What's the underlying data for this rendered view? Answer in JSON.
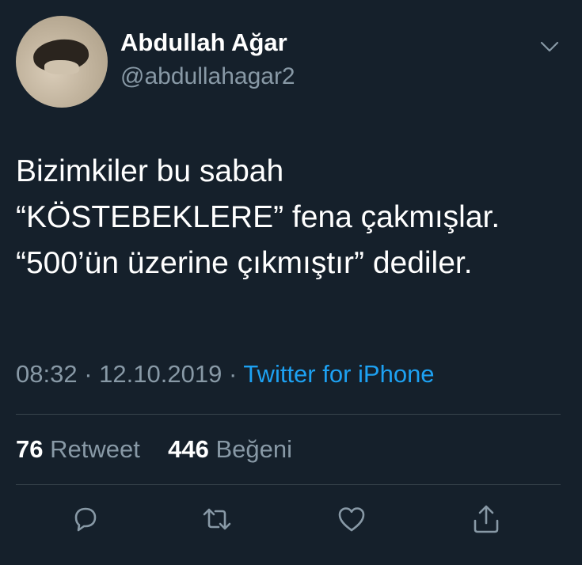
{
  "user": {
    "name": "Abdullah Ağar",
    "handle": "@abdullahagar2"
  },
  "tweet": {
    "lines": [
      "Bizimkiler bu sabah",
      "“KÖSTEBEKLERE” fena çakmışlar.",
      "“500’ün üzerine çıkmıştır” dediler."
    ],
    "time": "08:32",
    "separator": "·",
    "date": "12.10.2019",
    "source": "Twitter for iPhone"
  },
  "stats": {
    "retweets_count": "76",
    "retweets_label": "Retweet",
    "likes_count": "446",
    "likes_label": "Beğeni"
  },
  "icons": {
    "menu": "chevron-down-icon",
    "reply": "reply-icon",
    "retweet": "retweet-icon",
    "like": "heart-icon",
    "share": "share-icon"
  },
  "colors": {
    "background": "#15202b",
    "text": "#ffffff",
    "secondary": "#8899a6",
    "accent": "#1da1f2",
    "divider": "#38444d"
  }
}
